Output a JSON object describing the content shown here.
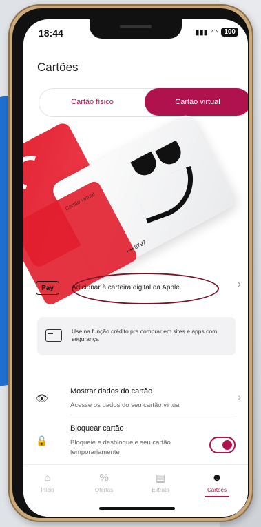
{
  "status_bar": {
    "time": "18:44",
    "battery": "100"
  },
  "page_title": "Cartões",
  "segments": {
    "physical": "Cartão físico",
    "virtual": "Cartão virtual"
  },
  "card": {
    "label": "Cartão virtual",
    "number_mask": "•••• 8797"
  },
  "apple_pay": {
    "logo": "Pay",
    "text": "Adicionar à carteira digital da Apple"
  },
  "info_box": {
    "text": "Use na função crédito pra comprar em sites e apps com segurança"
  },
  "show_data": {
    "title": "Mostrar dados do cartão",
    "subtitle": "Acesse os dados do seu cartão virtual"
  },
  "block_card": {
    "title": "Bloquear cartão",
    "subtitle": "Bloqueie e desbloqueie seu cartão temporariamente",
    "toggle_on": true
  },
  "tabs": [
    {
      "label": "Início",
      "icon": "home-icon"
    },
    {
      "label": "Ofertas",
      "icon": "discount-icon"
    },
    {
      "label": "Extrato",
      "icon": "receipt-icon"
    },
    {
      "label": "Cartões",
      "icon": "card-face-icon",
      "active": true
    }
  ],
  "colors": {
    "brand": "#b0124e",
    "card_red": "#e02030"
  }
}
